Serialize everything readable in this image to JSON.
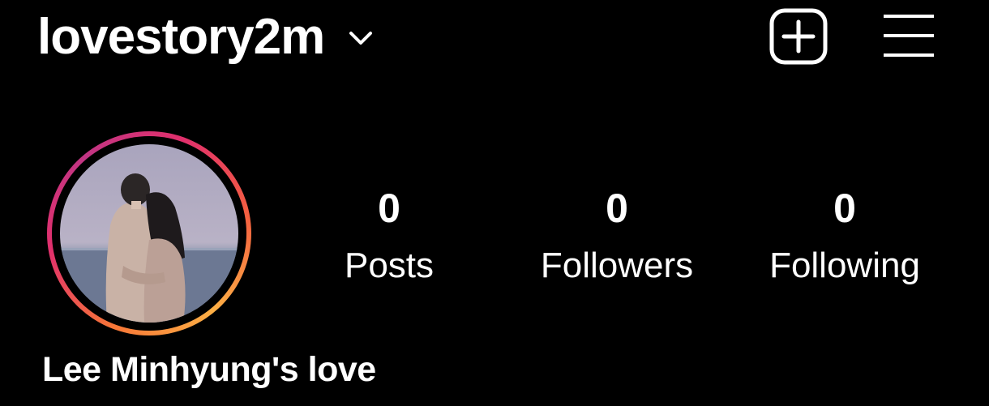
{
  "header": {
    "username": "lovestory2m",
    "chevron_icon": "chevron-down-icon",
    "add_icon": "add-post-icon",
    "menu_icon": "hamburger-menu-icon"
  },
  "profile": {
    "display_name": "Lee Minhyung's love",
    "avatar_ring_colors": [
      "#c13584",
      "#e1306c",
      "#f77737",
      "#fcaf45"
    ]
  },
  "stats": {
    "posts": {
      "count": "0",
      "label": "Posts"
    },
    "followers": {
      "count": "0",
      "label": "Followers"
    },
    "following": {
      "count": "0",
      "label": "Following"
    }
  },
  "theme": {
    "background": "#000000",
    "text": "#ffffff"
  }
}
